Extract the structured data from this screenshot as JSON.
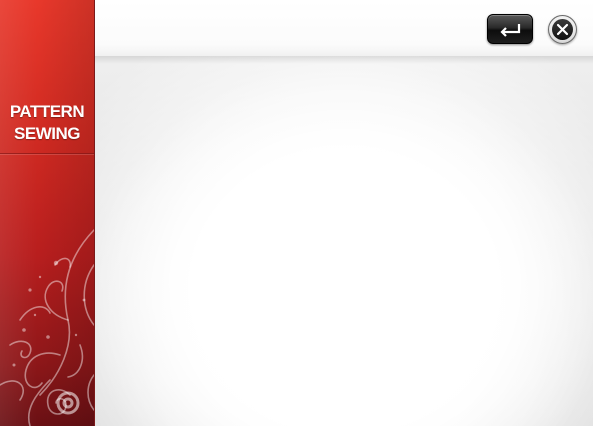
{
  "sidebar": {
    "title_line1": "PATTERN",
    "title_line2": "SEWING",
    "ornament_icon": "floral-swirl-ornament"
  },
  "toolbar": {
    "back_icon": "return-arrow-icon",
    "close_icon": "close-icon"
  },
  "colors": {
    "sidebar_red": "#d22b22",
    "sidebar_dark": "#6a1014",
    "button_dark": "#1e1e1e"
  }
}
